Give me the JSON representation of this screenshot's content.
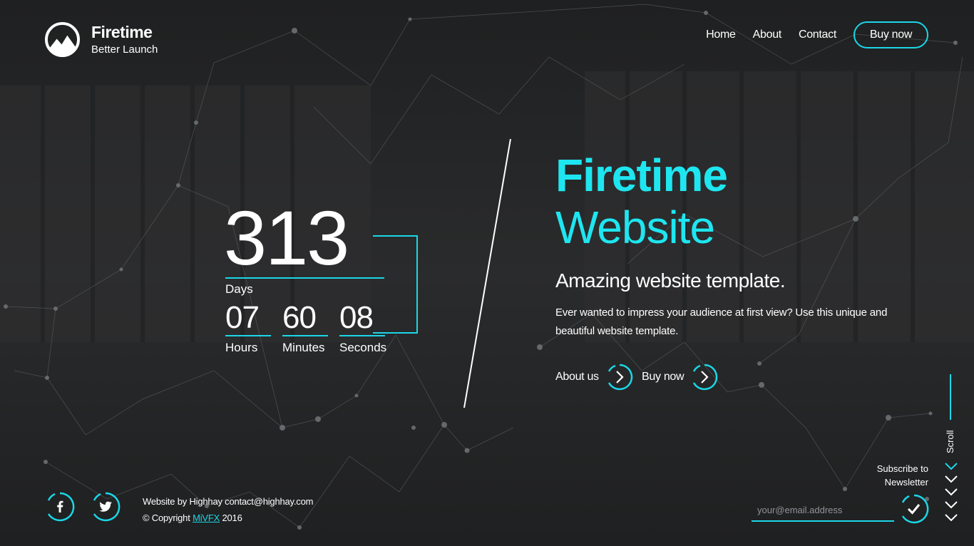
{
  "brand": {
    "title": "Firetime",
    "subtitle": "Better Launch"
  },
  "nav": {
    "items": [
      "Home",
      "About",
      "Contact"
    ],
    "buy_label": "Buy now"
  },
  "countdown": {
    "days": "313",
    "days_label": "Days",
    "units": [
      {
        "value": "07",
        "label": "Hours"
      },
      {
        "value": "60",
        "label": "Minutes"
      },
      {
        "value": "08",
        "label": "Seconds"
      }
    ]
  },
  "hero": {
    "title_bold": "Firetime",
    "title_light": "Website",
    "subtitle": "Amazing website template.",
    "description": "Ever wanted to impress your audience at first view? Use this unique and beautiful website template.",
    "cta_about": "About us",
    "cta_buy": "Buy now"
  },
  "scroll": {
    "label": "Scroll"
  },
  "footer": {
    "credit_line": "Website by Highhay contact@highhay.com",
    "copyright_prefix": "© Copyright",
    "copyright_link": "MiVFX",
    "copyright_year": "2016",
    "newsletter_line1": "Subscribe to",
    "newsletter_line2": "Newsletter",
    "email_placeholder": "your@email.address"
  },
  "icons": {
    "logo": "mountain-logo-icon",
    "facebook": "facebook-icon",
    "twitter": "twitter-icon",
    "arrow": "chevron-right-icon",
    "check": "check-icon",
    "scroll": "chevron-down-icon"
  },
  "colors": {
    "accent": "#1ad7e8",
    "hero_text": "#1ee6f0",
    "background": "#242526"
  }
}
